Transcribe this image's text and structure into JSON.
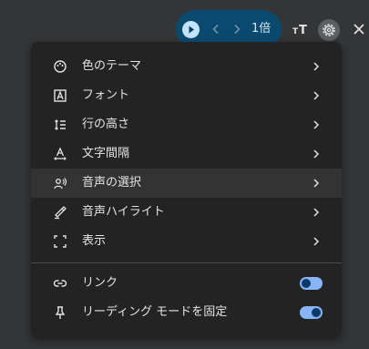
{
  "toolbar": {
    "speed_label": "1倍",
    "icons": [
      "play-icon",
      "previous-icon",
      "next-icon",
      "text-size-icon",
      "gear-icon",
      "close-icon"
    ]
  },
  "menu": {
    "items": [
      {
        "label": "色のテーマ",
        "icon": "palette-icon",
        "submenu": true
      },
      {
        "label": "フォント",
        "icon": "font-icon",
        "submenu": true
      },
      {
        "label": "行の高さ",
        "icon": "line-height-icon",
        "submenu": true
      },
      {
        "label": "文字間隔",
        "icon": "letter-spacing-icon",
        "submenu": true
      },
      {
        "label": "音声の選択",
        "icon": "voice-icon",
        "submenu": true,
        "highlighted": true
      },
      {
        "label": "音声ハイライト",
        "icon": "highlight-icon",
        "submenu": true
      },
      {
        "label": "表示",
        "icon": "fullscreen-icon",
        "submenu": true
      }
    ],
    "toggles": [
      {
        "label": "リンク",
        "icon": "link-icon",
        "on": false
      },
      {
        "label": "リーディング モードを固定",
        "icon": "pin-icon",
        "on": true
      }
    ]
  },
  "colors": {
    "background": "#333537",
    "menu_bg": "#232323",
    "accent": "#8ab4f8",
    "player_bg": "#0b4a6f"
  }
}
